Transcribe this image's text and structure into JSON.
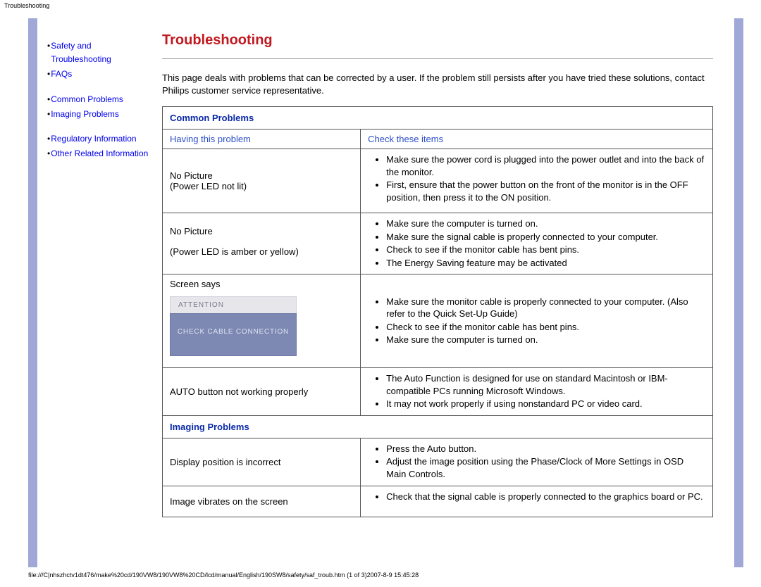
{
  "meta": {
    "topLabel": "Troubleshooting",
    "footer": "file:///C|nhszhctv1dt476/make%20cd/190VW8/190VW8%20CD/lcd/manual/English/190SW8/safety/saf_troub.htm (1 of 3)2007-8-9 15:45:28"
  },
  "sidebar": {
    "links": {
      "safety": "Safety and Troubleshooting",
      "faqs": "FAQs",
      "common": "Common Problems",
      "imaging": "Imaging Problems",
      "regulatory": "Regulatory Information",
      "other": "Other Related Information"
    }
  },
  "content": {
    "title": "Troubleshooting",
    "intro": "This page deals with problems that can be corrected by a user. If the problem still persists after you have tried these solutions, contact Philips customer service representative.",
    "sections": {
      "common": "Common Problems",
      "imaging": "Imaging Problems"
    },
    "headers": {
      "left": "Having this problem",
      "right": "Check these items"
    },
    "rows": {
      "r1": {
        "problemL1": "No Picture",
        "problemL2": "(Power LED not lit)",
        "c1": "Make sure the power cord is plugged into the power outlet and into the back of the monitor.",
        "c2": "First, ensure that the power button on the front of the monitor is in the OFF position, then press it to the ON position."
      },
      "r2": {
        "problemL1": "No Picture",
        "problemL2": "(Power LED is amber or yellow)",
        "c1": "Make sure the computer is turned on.",
        "c2": "Make sure the signal cable is properly connected to your computer.",
        "c3": "Check to see if the monitor cable has bent pins.",
        "c4": "The Energy Saving feature may be activated"
      },
      "r3": {
        "problemL1": "Screen says",
        "attTop": "ATTENTION",
        "attBody": "CHECK CABLE CONNECTION",
        "c1": "Make sure the monitor cable is properly connected to your computer. (Also refer to the Quick Set-Up Guide)",
        "c2": "Check to see if the monitor cable has bent pins.",
        "c3": "Make sure the computer is turned on."
      },
      "r4": {
        "problemL1": "AUTO button not working properly",
        "c1": "The Auto Function is designed for use on standard Macintosh or IBM-compatible PCs running Microsoft Windows.",
        "c2": "It may not work properly if using nonstandard PC or video card."
      },
      "r5": {
        "problemL1": "Display position is incorrect",
        "c1": "Press the Auto button.",
        "c2": "Adjust the image position using the Phase/Clock of More Settings in OSD Main Controls."
      },
      "r6": {
        "problemL1": "Image vibrates on the screen",
        "c1": "Check that the signal cable is properly connected to the graphics board or PC."
      }
    }
  }
}
